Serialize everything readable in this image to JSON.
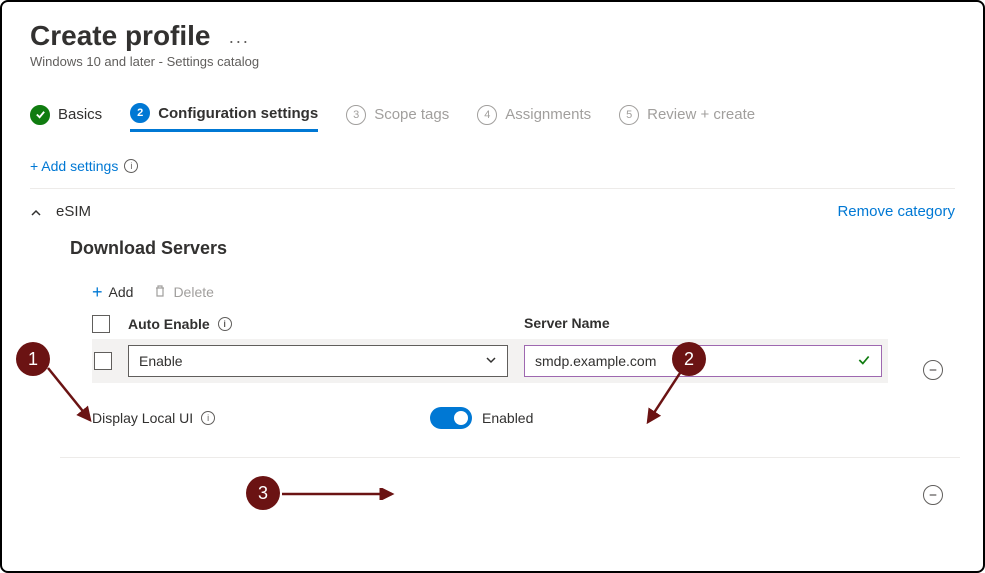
{
  "header": {
    "title": "Create profile",
    "subtitle": "Windows 10 and later - Settings catalog"
  },
  "stepper": {
    "step1": "Basics",
    "step2_num": "2",
    "step2": "Configuration settings",
    "step3_num": "3",
    "step3": "Scope tags",
    "step4_num": "4",
    "step4": "Assignments",
    "step5_num": "5",
    "step5": "Review + create"
  },
  "links": {
    "add_settings": "+ Add settings",
    "remove_category": "Remove category"
  },
  "category": {
    "name": "eSIM",
    "section": "Download Servers"
  },
  "actions": {
    "add": "Add",
    "delete": "Delete"
  },
  "columns": {
    "auto_enable": "Auto Enable",
    "server_name": "Server Name"
  },
  "row": {
    "select_value": "Enable",
    "server_value": "smdp.example.com"
  },
  "setting": {
    "label": "Display Local UI",
    "toggle_state": "Enabled"
  },
  "callouts": {
    "c1": "1",
    "c2": "2",
    "c3": "3"
  }
}
